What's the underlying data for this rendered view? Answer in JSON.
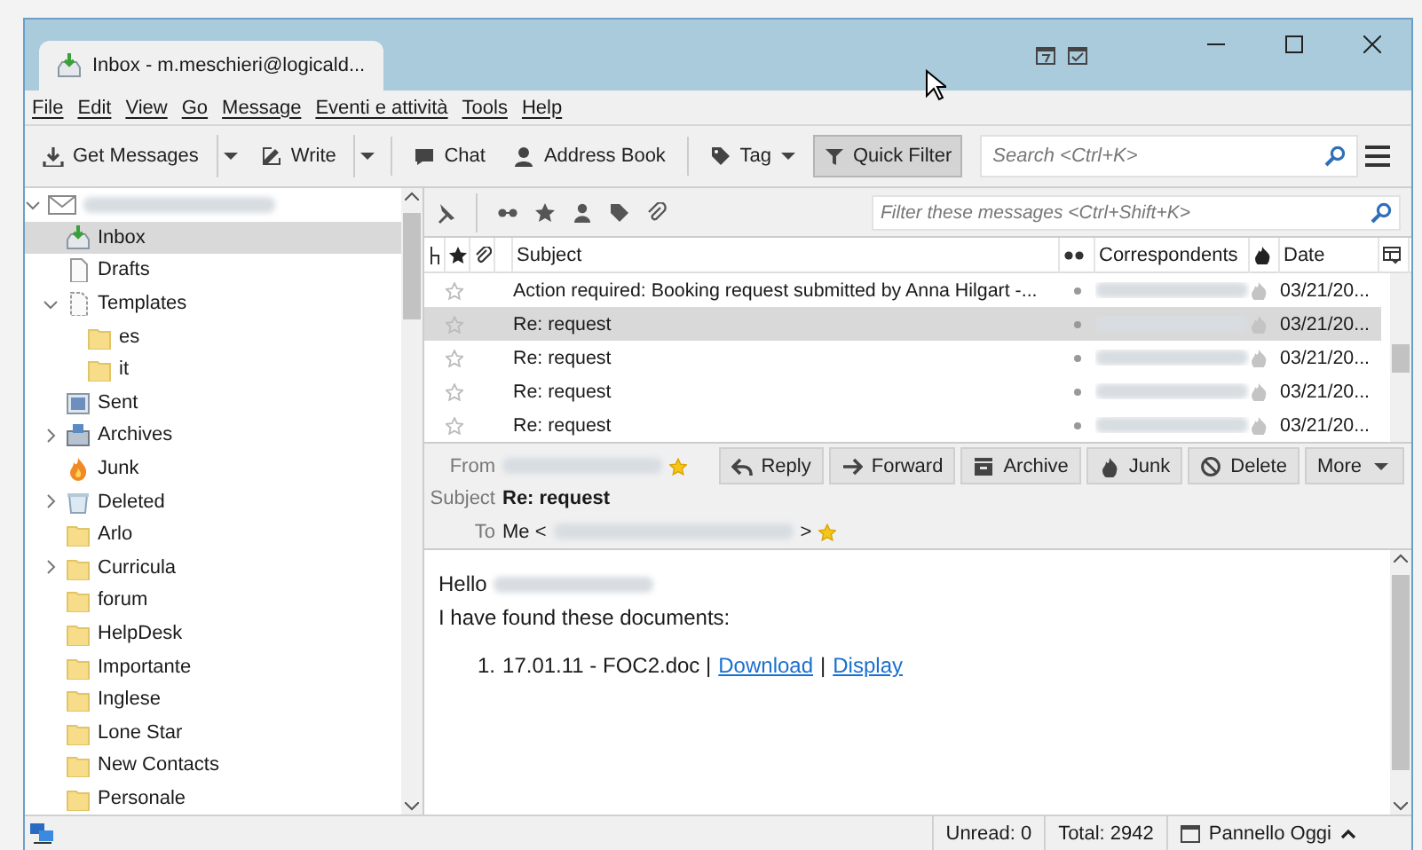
{
  "window": {
    "tab_title": "Inbox - m.meschieri@logicald..."
  },
  "menu": [
    "File",
    "Edit",
    "View",
    "Go",
    "Message",
    "Eventi e attività",
    "Tools",
    "Help"
  ],
  "toolbar": {
    "buttons": [
      {
        "kind": "split",
        "label": "Get Messages"
      },
      {
        "kind": "split",
        "label": "Write"
      },
      {
        "kind": "plain",
        "label": "Chat"
      },
      {
        "kind": "plain",
        "label": "Address Book"
      },
      {
        "kind": "menu",
        "label": "Tag"
      },
      {
        "kind": "toggle",
        "label": "Quick Filter",
        "selected": true
      }
    ],
    "search_placeholder": "Search <Ctrl+K>"
  },
  "folders": {
    "account_expanded": true,
    "items": [
      {
        "label": "Inbox",
        "kind": "inbox",
        "selected": true
      },
      {
        "label": "Drafts",
        "kind": "drafts",
        "selected": false
      },
      {
        "label": "Templates",
        "kind": "templates",
        "selected": false,
        "expanded": true,
        "children": [
          {
            "label": "es",
            "kind": "folder",
            "selected": false
          },
          {
            "label": "it",
            "kind": "folder",
            "selected": false
          }
        ]
      },
      {
        "label": "Sent",
        "kind": "sent",
        "selected": false
      },
      {
        "label": "Archives",
        "kind": "archives",
        "selected": false,
        "expanded": false
      },
      {
        "label": "Junk",
        "kind": "junk",
        "selected": false
      },
      {
        "label": "Deleted",
        "kind": "trash",
        "selected": false,
        "expanded": false
      },
      {
        "label": "Arlo",
        "kind": "folder",
        "selected": false
      },
      {
        "label": "Curricula",
        "kind": "folder",
        "selected": false,
        "expanded": false
      },
      {
        "label": "forum",
        "kind": "folder",
        "selected": false
      },
      {
        "label": "HelpDesk",
        "kind": "folder",
        "selected": false
      },
      {
        "label": "Importante",
        "kind": "folder",
        "selected": false
      },
      {
        "label": "Inglese",
        "kind": "folder",
        "selected": false
      },
      {
        "label": "Lone Star",
        "kind": "folder",
        "selected": false
      },
      {
        "label": "New Contacts",
        "kind": "folder",
        "selected": false
      },
      {
        "label": "Personale",
        "kind": "folder",
        "selected": false
      }
    ]
  },
  "message_list": {
    "filter_placeholder": "Filter these messages <Ctrl+Shift+K>",
    "columns": {
      "subject": "Subject",
      "correspondents": "Correspondents",
      "date": "Date"
    },
    "rows": [
      {
        "subject": "Action required: Booking request submitted by Anna Hilgart -...",
        "date": "03/21/20...",
        "selected": false,
        "starred": false
      },
      {
        "subject": "Re: request",
        "date": "03/21/20...",
        "selected": true,
        "starred": false
      },
      {
        "subject": "Re: request",
        "date": "03/21/20...",
        "selected": false,
        "starred": false
      },
      {
        "subject": "Re: request",
        "date": "03/21/20...",
        "selected": false,
        "starred": false
      },
      {
        "subject": "Re: request",
        "date": "03/21/20...",
        "selected": false,
        "starred": false
      }
    ]
  },
  "header": {
    "from_label": "From",
    "subject_label": "Subject",
    "subject": "Re: request",
    "to_label": "To",
    "to_prefix": "Me <",
    "to_suffix": ">",
    "buttons": [
      {
        "label": "Reply",
        "kind": "icon"
      },
      {
        "label": "Forward",
        "kind": "icon"
      },
      {
        "label": "Archive",
        "kind": "icon"
      },
      {
        "label": "Junk",
        "kind": "icon"
      },
      {
        "label": "Delete",
        "kind": "icon"
      },
      {
        "label": "More",
        "kind": "menu"
      }
    ]
  },
  "body": {
    "greeting": "Hello",
    "line": "I have found these documents:",
    "list": [
      {
        "number": "1.",
        "text": "17.01.11 - FOC2.doc |",
        "link_1": "Download",
        "separator": "|",
        "link_2": "Display"
      }
    ]
  },
  "status_bar": {
    "unread": "Unread: 0",
    "total": "Total: 2942",
    "today": "Pannello Oggi"
  }
}
